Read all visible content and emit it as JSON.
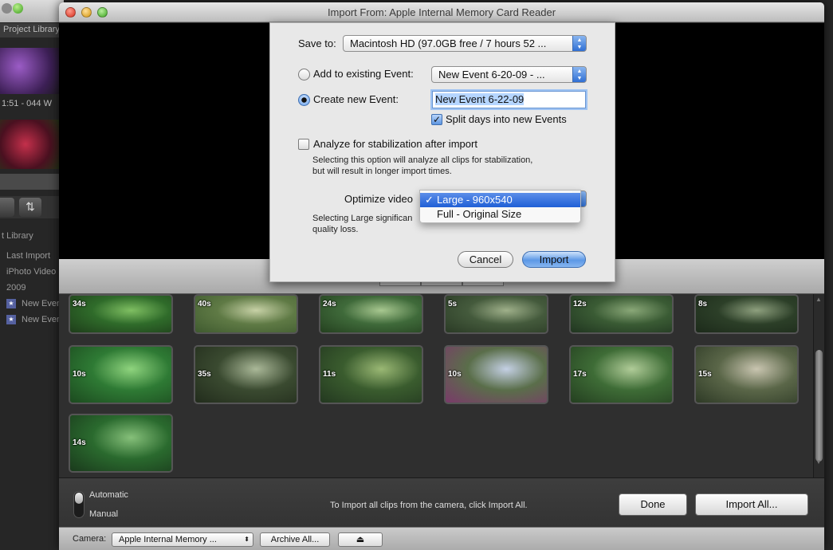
{
  "background": {
    "project_library": "Project Library",
    "clip_time": "1:51 - 044 W",
    "event_library": "t Library",
    "events": [
      "Last Import",
      "iPhoto Video",
      "2009",
      "New Even",
      "New Even"
    ]
  },
  "window": {
    "title": "Import From: Apple Internal Memory Card Reader"
  },
  "dialog": {
    "save_to_label": "Save to:",
    "save_to_value": "Macintosh HD (97.0GB free / 7 hours 52 ...",
    "add_existing_label": "Add to existing Event:",
    "existing_event_value": "New Event 6-20-09 - ...",
    "create_new_label": "Create new Event:",
    "new_event_name": "New Event 6-22-09",
    "split_days_label": "Split days into new Events",
    "analyze_label": "Analyze for stabilization after import",
    "analyze_note_1": "Selecting this option will analyze all clips for stabilization,",
    "analyze_note_2": "but will result in longer import times.",
    "optimize_label": "Optimize video",
    "optimize_note_1": "Selecting Large significan",
    "optimize_note_2": "quality loss.",
    "cancel_label": "Cancel",
    "import_label": "Import"
  },
  "optimize_menu": {
    "items": [
      "Large - 960x540",
      "Full - Original Size"
    ],
    "selected_mark": "✓"
  },
  "clips": [
    {
      "duration": "34s",
      "colors": [
        "#2f6b2a",
        "#7fbf62",
        "#1e3d1a"
      ]
    },
    {
      "duration": "40s",
      "colors": [
        "#5f7a45",
        "#c7d1a6",
        "#3f5a2f"
      ]
    },
    {
      "duration": "24s",
      "colors": [
        "#3f6a3a",
        "#a8c890",
        "#24401f"
      ]
    },
    {
      "duration": "5s",
      "colors": [
        "#445a3c",
        "#9fb08a",
        "#2a3a25"
      ]
    },
    {
      "duration": "12s",
      "colors": [
        "#3a5b34",
        "#8aa878",
        "#203520"
      ]
    },
    {
      "duration": "8s",
      "colors": [
        "#2c3f28",
        "#8ea07e",
        "#1c2a1a"
      ]
    },
    {
      "duration": "10s",
      "colors": [
        "#2e7a34",
        "#8fd47e",
        "#1c4a1f"
      ]
    },
    {
      "duration": "35s",
      "colors": [
        "#3a4a30",
        "#aab898",
        "#222c1c"
      ]
    },
    {
      "duration": "11s",
      "colors": [
        "#3a5c2e",
        "#9ab874",
        "#233820"
      ]
    },
    {
      "duration": "10s",
      "colors": [
        "#5a6e4a",
        "#c4d0e4",
        "#7a3a6a"
      ]
    },
    {
      "duration": "17s",
      "colors": [
        "#3e6c36",
        "#b0cc98",
        "#243f20"
      ]
    },
    {
      "duration": "15s",
      "colors": [
        "#5a6648",
        "#c9c5b0",
        "#2e3a26"
      ]
    },
    {
      "duration": "14s",
      "colors": [
        "#2a6a2e",
        "#86c07a",
        "#1a3a1c"
      ]
    }
  ],
  "bottom": {
    "automatic_label": "Automatic",
    "manual_label": "Manual",
    "hint": "To Import all clips from the camera, click Import All.",
    "done_label": "Done",
    "import_all_label": "Import All...",
    "camera_label": "Camera:",
    "camera_value": "Apple Internal Memory ...",
    "archive_label": "Archive All...",
    "eject_icon": "⏏"
  },
  "colors": {
    "accent": "#3a7be0",
    "selection": "#b5d5ff"
  }
}
